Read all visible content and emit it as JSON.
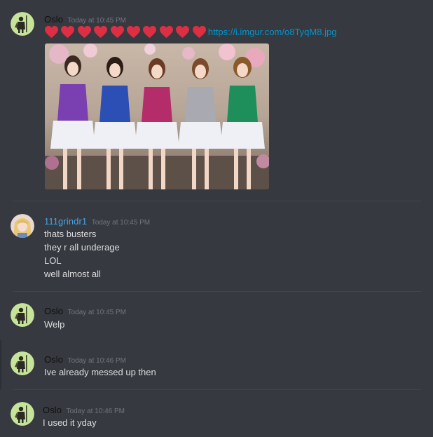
{
  "messages": [
    {
      "username": "Oslo",
      "timestamp": "Today at 10:45 PM",
      "emoji_count": 10,
      "link": "https://i.imgur.com/o8TyqM8.jpg",
      "image_alt": "photo of five girls in sequin tops and white tutu skirts"
    },
    {
      "username": "111grindr1",
      "timestamp": "Today at 10:45 PM",
      "lines": [
        "thats busters",
        "they r all underage",
        "LOL",
        "well almost all"
      ]
    },
    {
      "username": "Oslo",
      "timestamp": "Today at 10:45 PM",
      "lines": [
        "Welp"
      ]
    },
    {
      "username": "Oslo",
      "timestamp": "Today at 10:46 PM",
      "lines": [
        "Ive already messed up then"
      ]
    },
    {
      "username": "Oslo",
      "timestamp": "Today at 10:46 PM",
      "lines": [
        "I used it yday"
      ]
    }
  ],
  "colors": {
    "background": "#36393f",
    "username_blue": "#42a5e8",
    "link": "#0096cf",
    "heart": "#dd2e44",
    "timestamp": "#72767d",
    "avatar_bg": "#c5e49a"
  }
}
